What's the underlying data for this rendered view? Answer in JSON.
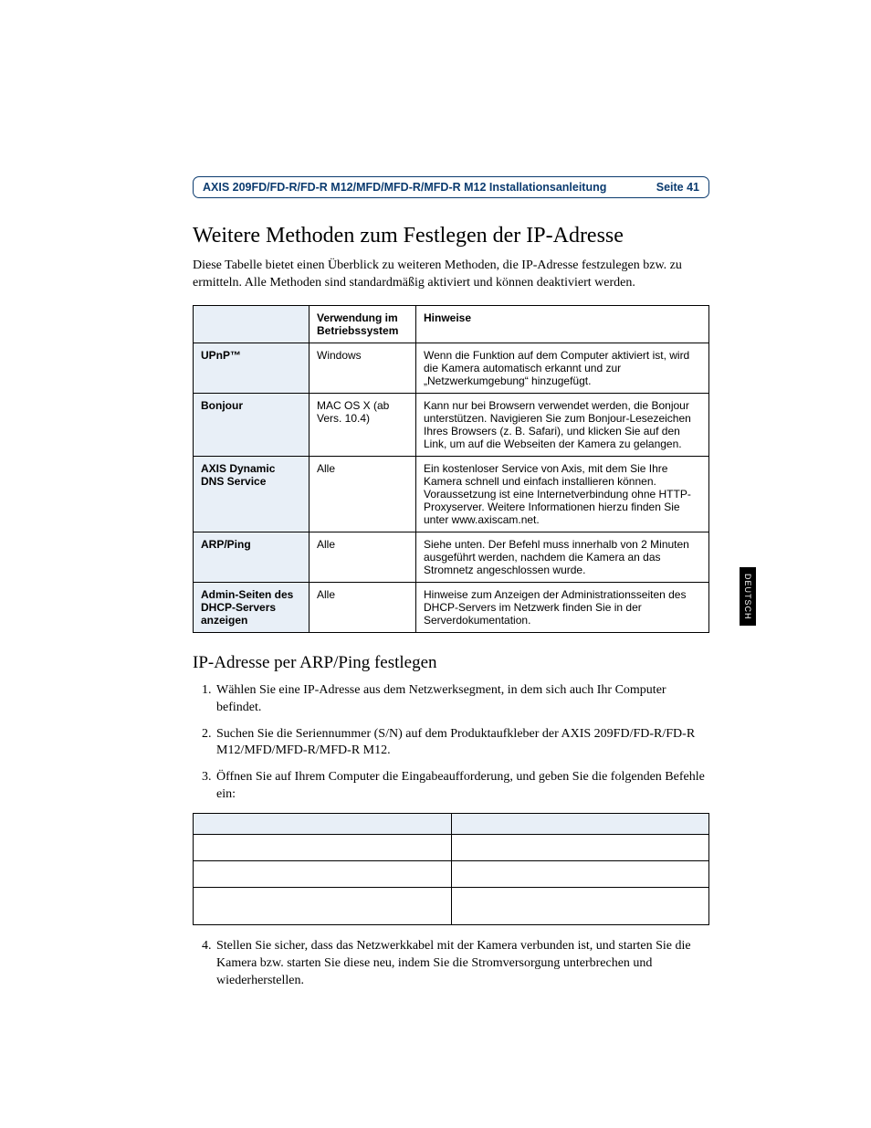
{
  "header": {
    "doc_title": "AXIS 209FD/FD-R/FD-R M12/MFD/MFD-R/MFD-R M12 Installationsanleitung",
    "page_label": "Seite 41"
  },
  "title": "Weitere Methoden zum Festlegen der IP-Adresse",
  "intro": "Diese Tabelle bietet einen Überblick zu weiteren Methoden, die IP-Adresse festzulegen bzw. zu ermitteln. Alle Methoden sind standardmäßig aktiviert und können deaktiviert werden.",
  "table": {
    "col_os": "Verwendung im Betriebssystem",
    "col_notes": "Hinweise",
    "rows": [
      {
        "name": "UPnP™",
        "os": "Windows",
        "notes": "Wenn die Funktion auf dem Computer aktiviert ist, wird die Kamera automatisch erkannt und zur „Netzwerkumgebung“ hinzugefügt."
      },
      {
        "name": "Bonjour",
        "os": "MAC OS X (ab Vers. 10.4)",
        "notes": "Kann nur bei Browsern verwendet werden, die Bonjour unterstützen. Navigieren Sie zum Bonjour-Lesezeichen Ihres Browsers (z. B. Safari), und klicken Sie auf den Link, um auf die Webseiten der Kamera zu gelangen."
      },
      {
        "name": "AXIS Dynamic DNS Service",
        "os": "Alle",
        "notes": "Ein kostenloser Service von Axis, mit dem Sie Ihre Kamera schnell und einfach installieren können. Voraussetzung ist eine Internetverbindung ohne HTTP-Proxyserver. Weitere Informationen hierzu finden Sie unter www.axiscam.net."
      },
      {
        "name": "ARP/Ping",
        "os": "Alle",
        "notes": "Siehe unten. Der Befehl muss innerhalb von 2 Minuten ausgeführt werden, nachdem die Kamera an das Stromnetz angeschlossen wurde."
      },
      {
        "name": "Admin-Seiten des DHCP-Servers anzeigen",
        "os": "Alle",
        "notes": "Hinweise zum Anzeigen der Administrationsseiten des DHCP-Servers im Netzwerk finden Sie in der Serverdokumentation."
      }
    ]
  },
  "subheading": "IP-Adresse per ARP/Ping festlegen",
  "steps": [
    "Wählen Sie eine IP-Adresse aus dem Netzwerksegment, in dem sich auch Ihr Computer befindet.",
    "Suchen Sie die Seriennummer (S/N) auf dem Produktaufkleber der AXIS 209FD/FD-R/FD-R M12/MFD/MFD-R/MFD-R M12.",
    "Öffnen Sie auf Ihrem Computer die Eingabeaufforderung, und geben Sie die folgenden Befehle ein:"
  ],
  "step4": "Stellen Sie sicher, dass das Netzwerkkabel mit der Kamera verbunden ist, und starten Sie die Kamera bzw. starten Sie diese neu, indem Sie die Stromversorgung unterbrechen und wiederherstellen.",
  "side_tab": "DEUTSCH"
}
